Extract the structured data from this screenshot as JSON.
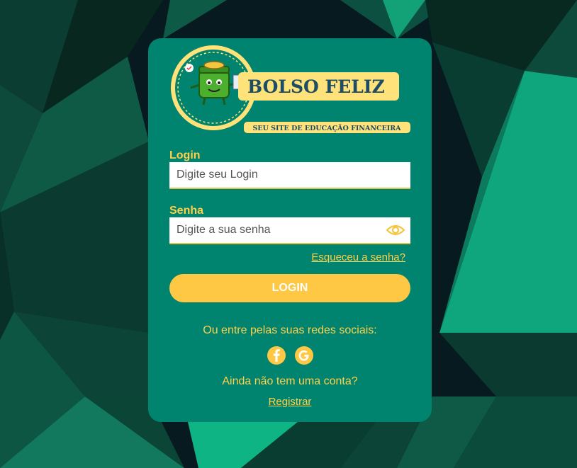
{
  "brand": {
    "name": "BOLSO FELIZ",
    "tagline": "SEU SITE DE EDUCAÇÃO FINANCEIRA"
  },
  "colors": {
    "card": "#00836f",
    "accent": "#ffc844",
    "label": "#ffd04a",
    "background": "#04131a"
  },
  "login_field": {
    "label": "Login",
    "placeholder": "Digite seu Login",
    "value": ""
  },
  "password_field": {
    "label": "Senha",
    "placeholder": "Digite a sua senha",
    "value": "",
    "toggle_icon": "eye-icon"
  },
  "forgot_password": "Esqueceu a senha?",
  "login_button": "LOGIN",
  "social": {
    "prompt": "Ou entre pelas suas redes sociais:",
    "icons": [
      "facebook-icon",
      "google-icon"
    ]
  },
  "signup": {
    "prompt": "Ainda não tem uma conta?",
    "link": "Registrar"
  }
}
